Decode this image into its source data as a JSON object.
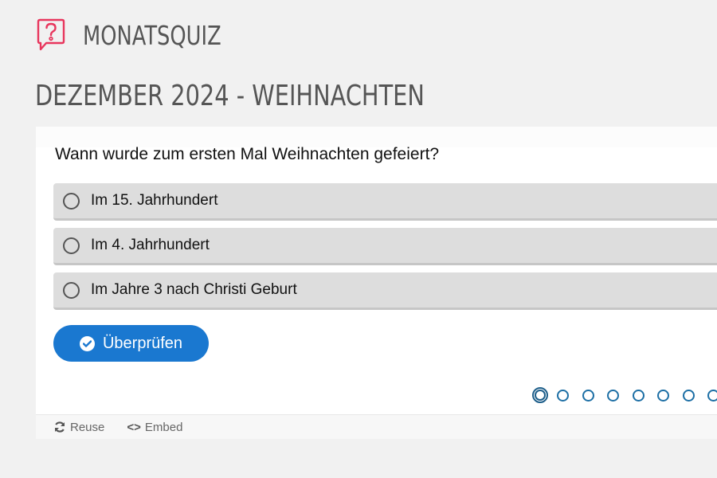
{
  "header": {
    "icon": "question-bubble-icon",
    "title": "MONATSQUIZ",
    "accent_color": "#e8365d"
  },
  "quiz": {
    "subtitle": "DEZEMBER 2024 - WEIHNACHTEN",
    "question": "Wann wurde zum ersten Mal Weihnachten gefeiert?",
    "options": [
      {
        "label": "Im 15. Jahrhundert",
        "selected": false
      },
      {
        "label": "Im 4. Jahrhundert",
        "selected": false
      },
      {
        "label": "Im Jahre 3 nach Christi Geburt",
        "selected": false
      }
    ],
    "check_button": {
      "label": "Überprüfen",
      "icon": "check-circle-icon",
      "color": "#1a78d0"
    },
    "progress": {
      "current_question": 1,
      "visible_dots": 8
    }
  },
  "footer": {
    "reuse_label": "Reuse",
    "reuse_icon": "refresh-icon",
    "embed_label": "Embed",
    "embed_icon": "code-icon"
  }
}
